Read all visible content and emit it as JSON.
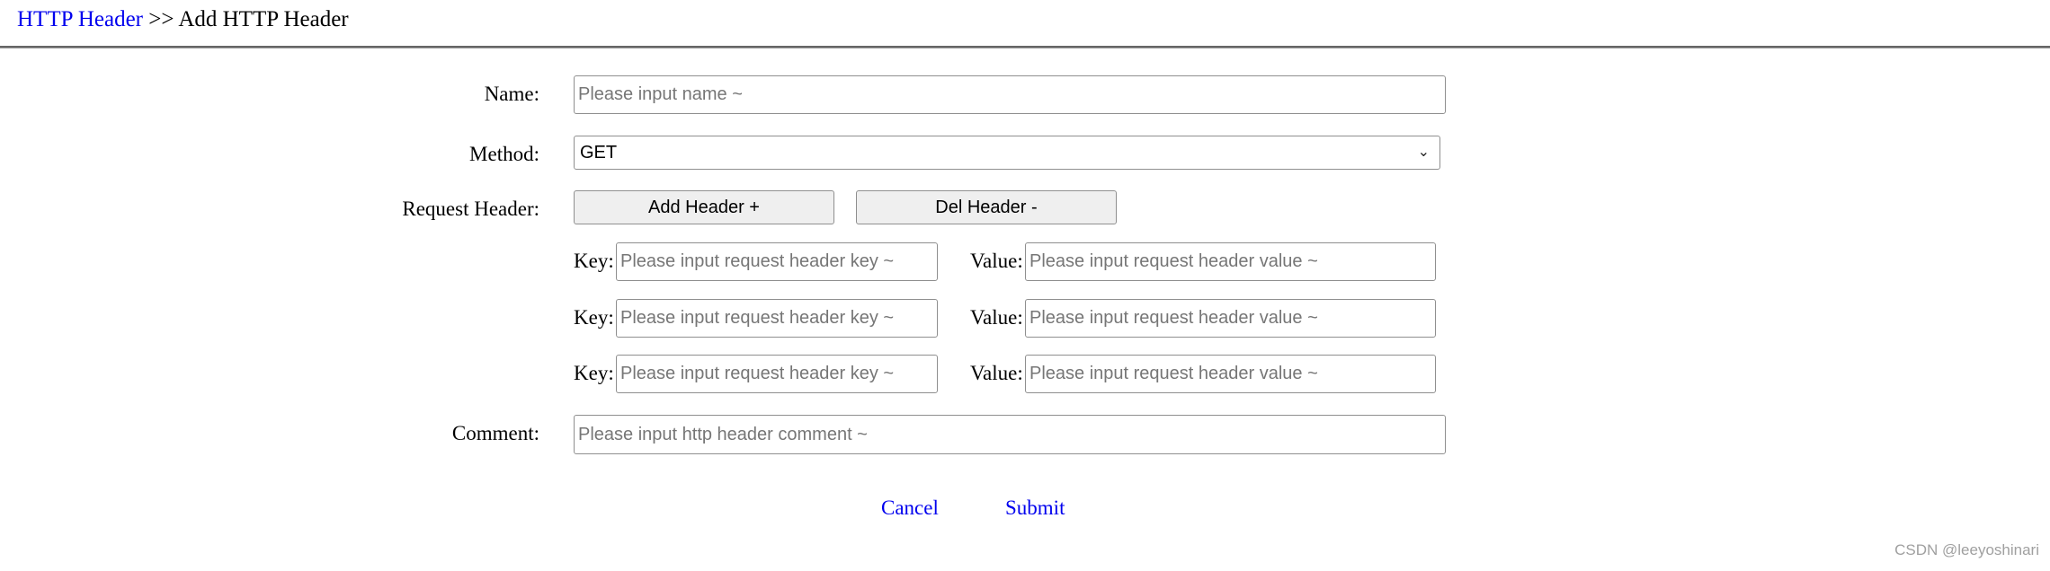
{
  "breadcrumb": {
    "parent": "HTTP Header",
    "separator": " >> ",
    "current": "Add HTTP Header"
  },
  "form": {
    "name": {
      "label": "Name:",
      "value": "",
      "placeholder": "Please input name ~"
    },
    "method": {
      "label": "Method:",
      "selected": "GET"
    },
    "request_header": {
      "label": "Request Header:",
      "add_button": "Add Header +",
      "del_button": "Del Header -",
      "rows": [
        {
          "key_label": "Key:",
          "key_placeholder": "Please input request header key ~",
          "value_label": "Value:",
          "value_placeholder": "Please input request header value ~"
        },
        {
          "key_label": "Key:",
          "key_placeholder": "Please input request header key ~",
          "value_label": "Value:",
          "value_placeholder": "Please input request header value ~"
        },
        {
          "key_label": "Key:",
          "key_placeholder": "Please input request header key ~",
          "value_label": "Value:",
          "value_placeholder": "Please input request header value ~"
        }
      ]
    },
    "comment": {
      "label": "Comment:",
      "value": "",
      "placeholder": "Please input http header comment ~"
    }
  },
  "actions": {
    "cancel": "Cancel",
    "submit": "Submit"
  },
  "watermark": "CSDN @leeyoshinari",
  "colors": {
    "link": "#0000ee",
    "rule": "#666666"
  }
}
